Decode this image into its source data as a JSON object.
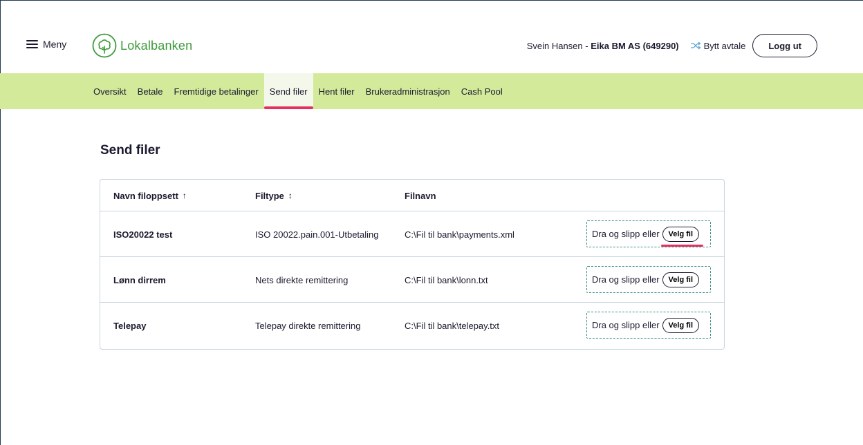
{
  "header": {
    "menu_label": "Meny",
    "logo_text": "Lokalbanken",
    "user_name": "Svein Hansen",
    "user_separator": " - ",
    "user_org": "Eika BM AS (649290)",
    "switch_label": "Bytt avtale",
    "logout_label": "Logg ut"
  },
  "nav": {
    "items": [
      {
        "label": "Oversikt"
      },
      {
        "label": "Betale"
      },
      {
        "label": "Fremtidige betalinger"
      },
      {
        "label": "Send filer"
      },
      {
        "label": "Hent filer"
      },
      {
        "label": "Brukeradministrasjon"
      },
      {
        "label": "Cash Pool"
      }
    ],
    "active": "Send filer"
  },
  "main": {
    "title": "Send filer",
    "table": {
      "headers": {
        "name": "Navn filoppsett",
        "name_sort": "↑",
        "type": "Filtype",
        "type_sort": "↕",
        "file": "Filnavn"
      },
      "rows": [
        {
          "name": "ISO20022 test",
          "type": "ISO 20022.pain.001-Utbetaling",
          "file": "C:\\Fil til bank\\payments.xml",
          "drop_text": "Dra og slipp eller",
          "button": "Velg fil"
        },
        {
          "name": "Lønn dirrem",
          "type": "Nets direkte remittering",
          "file": "C:\\Fil til bank\\lonn.txt",
          "drop_text": "Dra og slipp eller",
          "button": "Velg fil"
        },
        {
          "name": "Telepay",
          "type": "Telepay direkte remittering",
          "file": "C:\\Fil til bank\\telepay.txt",
          "drop_text": "Dra og slipp eller",
          "button": "Velg fil"
        }
      ]
    }
  },
  "colors": {
    "brand_green": "#3d9a3a",
    "nav_bg": "#d3ea9b",
    "active_underline": "#e5305e",
    "dropzone_border": "#3a8f89",
    "text": "#1a1a2e"
  },
  "icons": {
    "menu": "hamburger-icon",
    "logo": "tree-icon",
    "switch": "shuffle-icon",
    "sort_asc": "arrow-up-icon",
    "sort_both": "sort-icon"
  }
}
